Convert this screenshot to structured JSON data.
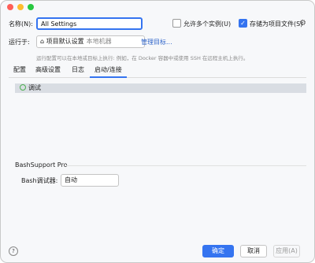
{
  "title_bar": {
    "traffic_lights": [
      "close",
      "minimize",
      "maximize"
    ]
  },
  "name": {
    "label": "名称(N):",
    "value": "All Settings"
  },
  "options": {
    "allow_multiple": {
      "label": "允许多个实例(U)",
      "checked": false
    },
    "store_as_project_file": {
      "label": "存储为项目文件(S)",
      "checked": true
    },
    "settings_icon": "gear-icon"
  },
  "run_on": {
    "label": "运行于:",
    "target_main": "项目默认设置",
    "target_sub": "本地机器",
    "target_icon": "home-icon",
    "manage_link": "管理目标..."
  },
  "hint": "运行配置可以在本地或目标上执行: 例如，在 Docker 容器中或使用 SSH 在远程主机上执行。",
  "tabs": [
    {
      "label": "配置",
      "active": false
    },
    {
      "label": "高级设置",
      "active": false
    },
    {
      "label": "日志",
      "active": false
    },
    {
      "label": "启动/连接",
      "active": true
    }
  ],
  "tree": {
    "items": [
      {
        "label": "调试",
        "icon": "debug-icon"
      }
    ]
  },
  "bashsupport": {
    "section_title": "BashSupport Pro",
    "debugger_label": "Bash调试器:",
    "debugger_value": "自动"
  },
  "footer": {
    "help_label": "?",
    "ok_label": "确定",
    "cancel_label": "取消",
    "apply_label": "应用(A)"
  },
  "colors": {
    "accent": "#3574f0",
    "link": "#2f65ca"
  }
}
